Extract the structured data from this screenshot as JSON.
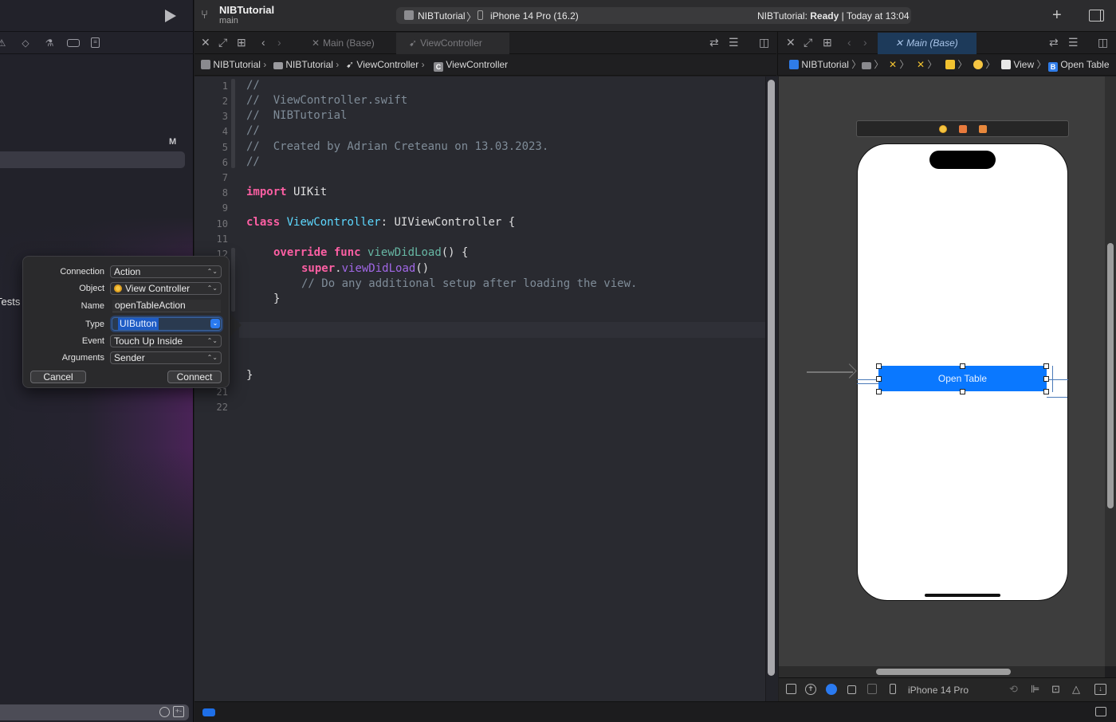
{
  "toolbar": {
    "project_title": "NIBTutorial",
    "branch": "main",
    "scheme": {
      "project": "NIBTutorial",
      "device": "iPhone 14 Pro (16.2)"
    },
    "status": {
      "project": "NIBTutorial:",
      "state": "Ready",
      "separator": "|",
      "time": "Today at 13:04"
    },
    "add_label": "+"
  },
  "navigator": {
    "tool_icons": [
      "warning-icon",
      "breakpoint-icon",
      "test-icon",
      "debug-icon",
      "report-icon"
    ],
    "source_control_badge": "M",
    "partial_item_label": "Tests"
  },
  "left_editor": {
    "tabs": [
      {
        "label": "Main (Base)",
        "icon": "interface-builder-icon",
        "active": false
      },
      {
        "label": "ViewController",
        "icon": "swift-icon",
        "active": false
      }
    ],
    "jumpbar": [
      "NIBTutorial",
      "NIBTutorial",
      "ViewController",
      "ViewController"
    ],
    "line_numbers": [
      "1",
      "2",
      "3",
      "4",
      "5",
      "6",
      "7",
      "8",
      "9",
      "10",
      "11",
      "12",
      "21",
      "22"
    ],
    "code": {
      "l1": "//",
      "l2": "//  ViewController.swift",
      "l3": "//  NIBTutorial",
      "l4": "//",
      "l5": "//  Created by Adrian Creteanu on 13.03.2023.",
      "l6": "//",
      "l8_kw": "import",
      "l8_rest": " UIKit",
      "l10_kw": "class",
      "l10_name": "ViewController",
      "l10_colon": ": ",
      "l10_super": "UIViewController",
      "l10_brace": " {",
      "l12_kw1": "override",
      "l12_kw2": "func",
      "l12_name": "viewDidLoad",
      "l12_rest": "() {",
      "l13_kw": "super",
      "l13_dot": ".",
      "l13_call": "viewDidLoad",
      "l13_rest": "()",
      "l14": "// Do any additional setup after loading the view.",
      "l15": "}",
      "l20": "}"
    }
  },
  "right_editor": {
    "tabs": [
      {
        "label": "Main (Base)",
        "active": true
      }
    ],
    "jumpbar": {
      "project": "NIBTutorial",
      "view": "View",
      "button": "Open Table"
    },
    "canvas": {
      "button_label": "Open Table"
    },
    "bottom_device": "iPhone 14 Pro"
  },
  "connection_popover": {
    "labels": {
      "connection": "Connection",
      "object": "Object",
      "name": "Name",
      "type": "Type",
      "event": "Event",
      "arguments": "Arguments"
    },
    "values": {
      "connection": "Action",
      "object": "View Controller",
      "name": "openTableAction",
      "type": "UIButton",
      "event": "Touch Up Inside",
      "arguments": "Sender"
    },
    "cancel_label": "Cancel",
    "connect_label": "Connect"
  },
  "colors": {
    "accent": "#0a78ff",
    "keyword": "#fc5fa3",
    "comment": "#7f8c98",
    "type": "#5dd8ff"
  }
}
